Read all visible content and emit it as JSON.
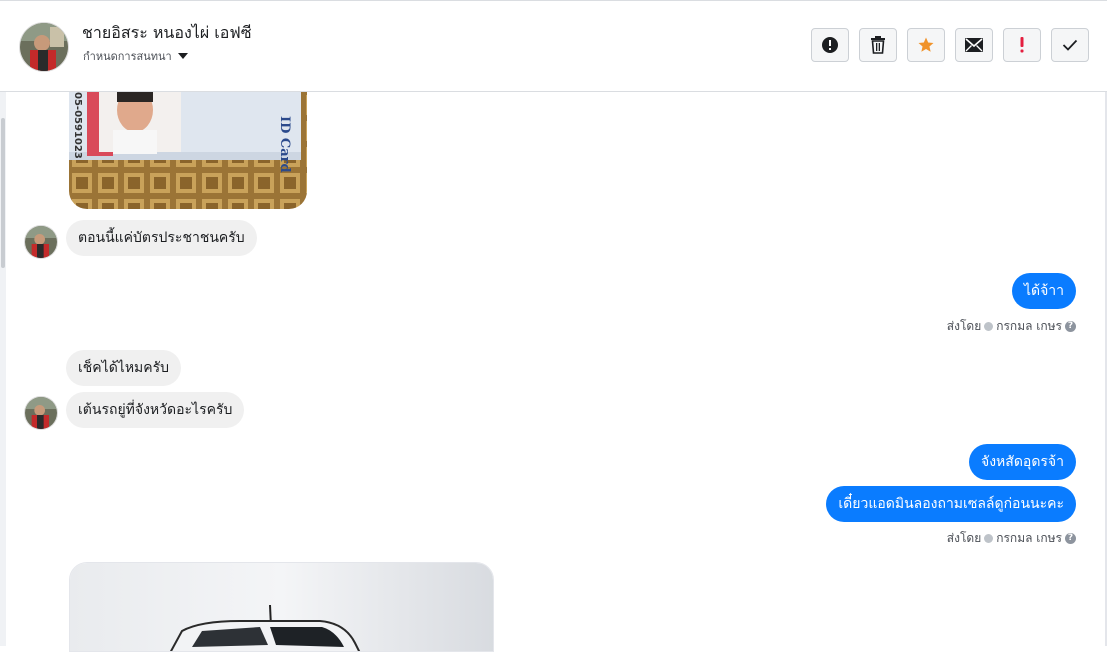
{
  "header": {
    "name": "ชายอิสระ หนองไผ่ เอฟซี",
    "subtitle": "กำหนดการสนทนา",
    "actions": [
      {
        "id": "report",
        "icon": "alert-circle-icon",
        "color": "#1c1e21"
      },
      {
        "id": "delete",
        "icon": "trash-icon",
        "color": "#1c1e21"
      },
      {
        "id": "star",
        "icon": "star-icon",
        "color": "#f0932b"
      },
      {
        "id": "mail",
        "icon": "envelope-icon",
        "color": "#1c1e21"
      },
      {
        "id": "important",
        "icon": "exclamation-icon",
        "color": "#e41e3f"
      },
      {
        "id": "done",
        "icon": "check-icon",
        "color": "#1c1e21"
      }
    ]
  },
  "id_card_label": "ID Card",
  "id_card_number": "05-0591023",
  "messages": {
    "m1": "ตอนนี้แค่บัตรประชาชนครับ",
    "m2": "ได้จ้าา",
    "m3": "เช็คได้ไหมครับ",
    "m4": "เต้นรถยู่ที่จังหวัดอะไรครับ",
    "m5": "จังหสัดอุดรจ้า",
    "m6": "เดี๋ยวแอดมินลองถามเซลล์ดูก่อนนะคะ"
  },
  "sent_by": {
    "prefix": "ส่งโดย",
    "agent": "กรกมล เกษร"
  },
  "colors": {
    "outgoing_bubble": "#0a7cff",
    "incoming_bubble": "#f0f0f0"
  }
}
